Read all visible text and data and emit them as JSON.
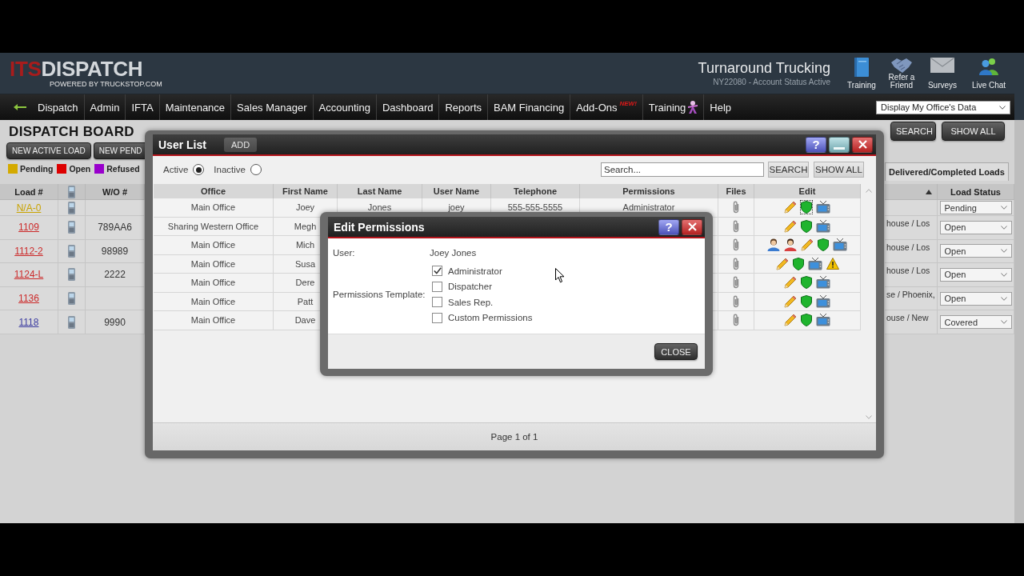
{
  "header": {
    "logo": {
      "accent": "ITS",
      "name": "DISPATCH",
      "tagline": "POWERED BY TRUCKSTOP.COM"
    },
    "company": "Turnaround Trucking",
    "account": "NY22080 - Account Status Active",
    "quick_links": [
      {
        "kind": "book",
        "label": "Training"
      },
      {
        "kind": "handshake",
        "label": "Refer a Friend"
      },
      {
        "kind": "envelope",
        "label": "Surveys"
      },
      {
        "kind": "people",
        "label": "Live Chat"
      }
    ]
  },
  "nav": {
    "items": [
      {
        "kind": "link",
        "label": "Dispatch"
      },
      {
        "kind": "link",
        "label": "Admin"
      },
      {
        "kind": "link",
        "label": "IFTA"
      },
      {
        "kind": "link",
        "label": "Maintenance"
      },
      {
        "kind": "link",
        "label": "Sales Manager"
      },
      {
        "kind": "link",
        "label": "Accounting"
      },
      {
        "kind": "link",
        "label": "Dashboard"
      },
      {
        "kind": "link",
        "label": "Reports"
      },
      {
        "kind": "link",
        "label": "BAM Financing"
      },
      {
        "kind": "badge",
        "label": "Add-Ons",
        "badge": "NEW!"
      },
      {
        "kind": "icon",
        "label": "Training"
      },
      {
        "kind": "link",
        "label": "Help"
      }
    ],
    "office_select": "Display My Office's Data"
  },
  "dispatch_board": {
    "title": "DISPATCH BOARD",
    "buttons": [
      "NEW ACTIVE LOAD",
      "NEW PEND"
    ],
    "legend": [
      {
        "label": "Pending",
        "color": "#d4aa00"
      },
      {
        "label": "Open",
        "color": "#dd0000"
      },
      {
        "label": "Refused",
        "color": "#9900cc"
      }
    ],
    "search_buttons": [
      "SEARCH",
      "SHOW ALL"
    ],
    "tab": "Delivered/Completed Loads",
    "columns": {
      "load": "Load #",
      "work_order": "W/O #",
      "status": "Load Status"
    },
    "loads": [
      {
        "load": "N/A-0",
        "color": "#c9a300",
        "status": "Pending"
      },
      {
        "load": "1109",
        "color": "#cc2a2a",
        "work_order": "789AA6",
        "route": "house / Los",
        "status": "Open"
      },
      {
        "load": "1112-2",
        "color": "#cc2a2a",
        "work_order": "98989",
        "route": "house / Los",
        "status": "Open"
      },
      {
        "load": "1124-L",
        "color": "#cc2a2a",
        "work_order": "2222",
        "route": "house / Los",
        "status": "Open"
      },
      {
        "load": "1136",
        "color": "#cc2a2a",
        "route": "se / Phoenix,",
        "status": "Open"
      },
      {
        "load": "1118",
        "color": "#3b3ba0",
        "work_order": "9990",
        "route": "ouse / New",
        "status": "Covered"
      }
    ]
  },
  "user_list": {
    "title": "User List",
    "add_button": "ADD",
    "help_label": "?",
    "filters": [
      {
        "label": "Active",
        "selected": true
      },
      {
        "label": "Inactive",
        "selected": false
      }
    ],
    "search": {
      "placeholder": "Search..."
    },
    "buttons": [
      "SEARCH",
      "SHOW ALL"
    ],
    "columns": [
      "Office",
      "First Name",
      "Last Name",
      "User Name",
      "Telephone",
      "Permissions",
      "Files",
      "Edit"
    ],
    "rows": [
      {
        "office": "Main Office",
        "first_name": "Joey",
        "last_name": "Jones",
        "user_name": "joey",
        "telephone": "555-555-5555",
        "permissions": "Administrator",
        "actions": [
          {
            "kind": "edit",
            "focused": false
          },
          {
            "kind": "permissions",
            "focused": true
          },
          {
            "kind": "display",
            "focused": false
          }
        ]
      },
      {
        "office": "Sharing Western Office",
        "first_name": "Megh",
        "actions": [
          {
            "kind": "edit",
            "focused": false
          },
          {
            "kind": "permissions",
            "focused": false
          },
          {
            "kind": "display",
            "focused": false
          }
        ]
      },
      {
        "office": "Main Office",
        "first_name": "Mich",
        "actions": [
          {
            "kind": "person_male",
            "focused": false
          },
          {
            "kind": "person_female",
            "focused": false
          },
          {
            "kind": "edit",
            "focused": false
          },
          {
            "kind": "permissions",
            "focused": false
          },
          {
            "kind": "display",
            "focused": false
          }
        ]
      },
      {
        "office": "Main Office",
        "first_name": "Susa",
        "actions": [
          {
            "kind": "edit",
            "focused": false
          },
          {
            "kind": "permissions",
            "focused": false
          },
          {
            "kind": "display",
            "focused": false
          },
          {
            "kind": "warning",
            "focused": false
          }
        ]
      },
      {
        "office": "Main Office",
        "first_name": "Dere",
        "actions": [
          {
            "kind": "edit",
            "focused": false
          },
          {
            "kind": "permissions",
            "focused": false
          },
          {
            "kind": "display",
            "focused": false
          }
        ]
      },
      {
        "office": "Main Office",
        "first_name": "Patt",
        "actions": [
          {
            "kind": "edit",
            "focused": false
          },
          {
            "kind": "permissions",
            "focused": false
          },
          {
            "kind": "display",
            "focused": false
          }
        ]
      },
      {
        "office": "Main Office",
        "first_name": "Dave",
        "actions": [
          {
            "kind": "edit",
            "focused": false
          },
          {
            "kind": "permissions",
            "focused": false
          },
          {
            "kind": "display",
            "focused": false
          }
        ]
      }
    ],
    "footer": "Page 1 of 1"
  },
  "edit_permissions": {
    "title": "Edit Permissions",
    "help_label": "?",
    "user_label": "User:",
    "user_name": "Joey Jones",
    "template_label": "Permissions Template:",
    "templates": [
      {
        "label": "Administrator",
        "checked": true
      },
      {
        "label": "Dispatcher",
        "checked": false
      },
      {
        "label": "Sales Rep.",
        "checked": false
      },
      {
        "label": "Custom Permissions",
        "checked": false
      }
    ],
    "close_button": "CLOSE"
  }
}
